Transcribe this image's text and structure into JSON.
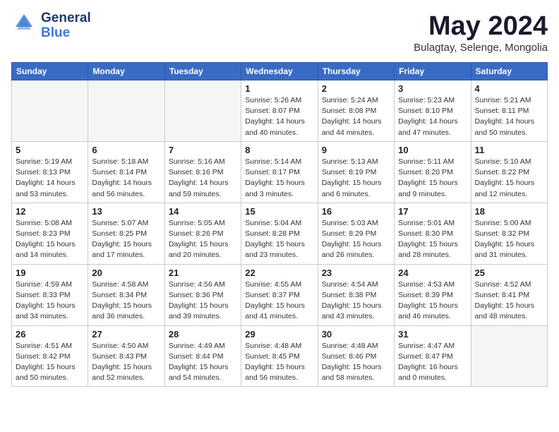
{
  "header": {
    "logo_line1": "General",
    "logo_line2": "Blue",
    "month": "May 2024",
    "location": "Bulagtay, Selenge, Mongolia"
  },
  "days_of_week": [
    "Sunday",
    "Monday",
    "Tuesday",
    "Wednesday",
    "Thursday",
    "Friday",
    "Saturday"
  ],
  "weeks": [
    [
      {
        "day": "",
        "info": ""
      },
      {
        "day": "",
        "info": ""
      },
      {
        "day": "",
        "info": ""
      },
      {
        "day": "1",
        "info": "Sunrise: 5:26 AM\nSunset: 8:07 PM\nDaylight: 14 hours\nand 40 minutes."
      },
      {
        "day": "2",
        "info": "Sunrise: 5:24 AM\nSunset: 8:08 PM\nDaylight: 14 hours\nand 44 minutes."
      },
      {
        "day": "3",
        "info": "Sunrise: 5:23 AM\nSunset: 8:10 PM\nDaylight: 14 hours\nand 47 minutes."
      },
      {
        "day": "4",
        "info": "Sunrise: 5:21 AM\nSunset: 8:11 PM\nDaylight: 14 hours\nand 50 minutes."
      }
    ],
    [
      {
        "day": "5",
        "info": "Sunrise: 5:19 AM\nSunset: 8:13 PM\nDaylight: 14 hours\nand 53 minutes."
      },
      {
        "day": "6",
        "info": "Sunrise: 5:18 AM\nSunset: 8:14 PM\nDaylight: 14 hours\nand 56 minutes."
      },
      {
        "day": "7",
        "info": "Sunrise: 5:16 AM\nSunset: 8:16 PM\nDaylight: 14 hours\nand 59 minutes."
      },
      {
        "day": "8",
        "info": "Sunrise: 5:14 AM\nSunset: 8:17 PM\nDaylight: 15 hours\nand 3 minutes."
      },
      {
        "day": "9",
        "info": "Sunrise: 5:13 AM\nSunset: 8:19 PM\nDaylight: 15 hours\nand 6 minutes."
      },
      {
        "day": "10",
        "info": "Sunrise: 5:11 AM\nSunset: 8:20 PM\nDaylight: 15 hours\nand 9 minutes."
      },
      {
        "day": "11",
        "info": "Sunrise: 5:10 AM\nSunset: 8:22 PM\nDaylight: 15 hours\nand 12 minutes."
      }
    ],
    [
      {
        "day": "12",
        "info": "Sunrise: 5:08 AM\nSunset: 8:23 PM\nDaylight: 15 hours\nand 14 minutes."
      },
      {
        "day": "13",
        "info": "Sunrise: 5:07 AM\nSunset: 8:25 PM\nDaylight: 15 hours\nand 17 minutes."
      },
      {
        "day": "14",
        "info": "Sunrise: 5:05 AM\nSunset: 8:26 PM\nDaylight: 15 hours\nand 20 minutes."
      },
      {
        "day": "15",
        "info": "Sunrise: 5:04 AM\nSunset: 8:28 PM\nDaylight: 15 hours\nand 23 minutes."
      },
      {
        "day": "16",
        "info": "Sunrise: 5:03 AM\nSunset: 8:29 PM\nDaylight: 15 hours\nand 26 minutes."
      },
      {
        "day": "17",
        "info": "Sunrise: 5:01 AM\nSunset: 8:30 PM\nDaylight: 15 hours\nand 28 minutes."
      },
      {
        "day": "18",
        "info": "Sunrise: 5:00 AM\nSunset: 8:32 PM\nDaylight: 15 hours\nand 31 minutes."
      }
    ],
    [
      {
        "day": "19",
        "info": "Sunrise: 4:59 AM\nSunset: 8:33 PM\nDaylight: 15 hours\nand 34 minutes."
      },
      {
        "day": "20",
        "info": "Sunrise: 4:58 AM\nSunset: 8:34 PM\nDaylight: 15 hours\nand 36 minutes."
      },
      {
        "day": "21",
        "info": "Sunrise: 4:56 AM\nSunset: 8:36 PM\nDaylight: 15 hours\nand 39 minutes."
      },
      {
        "day": "22",
        "info": "Sunrise: 4:55 AM\nSunset: 8:37 PM\nDaylight: 15 hours\nand 41 minutes."
      },
      {
        "day": "23",
        "info": "Sunrise: 4:54 AM\nSunset: 8:38 PM\nDaylight: 15 hours\nand 43 minutes."
      },
      {
        "day": "24",
        "info": "Sunrise: 4:53 AM\nSunset: 8:39 PM\nDaylight: 15 hours\nand 46 minutes."
      },
      {
        "day": "25",
        "info": "Sunrise: 4:52 AM\nSunset: 8:41 PM\nDaylight: 15 hours\nand 48 minutes."
      }
    ],
    [
      {
        "day": "26",
        "info": "Sunrise: 4:51 AM\nSunset: 8:42 PM\nDaylight: 15 hours\nand 50 minutes."
      },
      {
        "day": "27",
        "info": "Sunrise: 4:50 AM\nSunset: 8:43 PM\nDaylight: 15 hours\nand 52 minutes."
      },
      {
        "day": "28",
        "info": "Sunrise: 4:49 AM\nSunset: 8:44 PM\nDaylight: 15 hours\nand 54 minutes."
      },
      {
        "day": "29",
        "info": "Sunrise: 4:48 AM\nSunset: 8:45 PM\nDaylight: 15 hours\nand 56 minutes."
      },
      {
        "day": "30",
        "info": "Sunrise: 4:48 AM\nSunset: 8:46 PM\nDaylight: 15 hours\nand 58 minutes."
      },
      {
        "day": "31",
        "info": "Sunrise: 4:47 AM\nSunset: 8:47 PM\nDaylight: 16 hours\nand 0 minutes."
      },
      {
        "day": "",
        "info": ""
      }
    ]
  ]
}
